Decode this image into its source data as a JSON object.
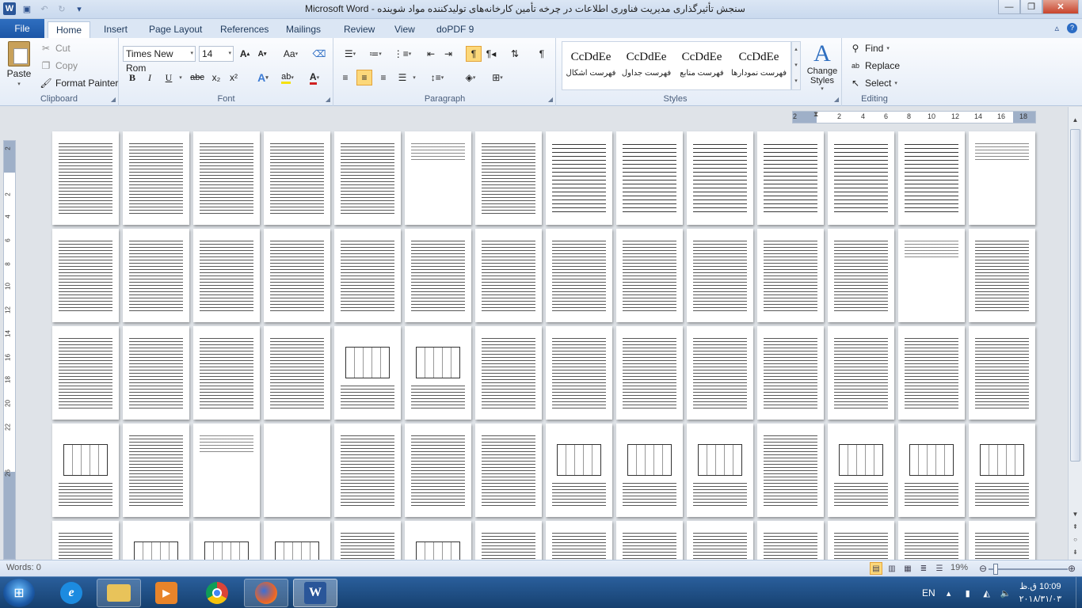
{
  "window": {
    "title": "سنجش تأثیرگذاری مدیریت فناوری اطلاعات در چرخه تأمین کارخانه‌های تولیدکننده مواد شوینده  -  Microsoft Word"
  },
  "quick_access": {
    "icons": [
      "word-icon",
      "save-icon",
      "undo-icon",
      "redo-icon",
      "customize-icon"
    ]
  },
  "tabs": [
    "File",
    "Home",
    "Insert",
    "Page Layout",
    "References",
    "Mailings",
    "Review",
    "View",
    "doPDF 9"
  ],
  "active_tab": "Home",
  "clipboard": {
    "paste": "Paste",
    "cut": "Cut",
    "copy": "Copy",
    "format_painter": "Format Painter",
    "label": "Clipboard"
  },
  "font": {
    "name": "Times New Rom",
    "size": "14",
    "label": "Font",
    "bold": "B",
    "italic": "I",
    "underline": "U",
    "strike": "abc",
    "subscript": "x₂",
    "superscript": "x²",
    "grow": "A",
    "shrink": "A",
    "change_case": "Aa"
  },
  "paragraph": {
    "label": "Paragraph",
    "pilcrow": "¶"
  },
  "styles": {
    "label": "Styles",
    "items": [
      {
        "sample": "CcDdEe",
        "name": "فهرست اشکال"
      },
      {
        "sample": "CcDdEe",
        "name": "فهرست جداول"
      },
      {
        "sample": "CcDdEe",
        "name": "فهرست منابع"
      },
      {
        "sample": "CcDdEe",
        "name": "فهرست نمودارها"
      }
    ],
    "change_styles": "Change Styles"
  },
  "editing": {
    "label": "Editing",
    "find": "Find",
    "replace": "Replace",
    "select": "Select"
  },
  "ruler": {
    "top_ticks": [
      "2",
      "2",
      "4",
      "6",
      "8",
      "10",
      "12",
      "14",
      "16",
      "18"
    ],
    "left_ticks": [
      "2",
      "2",
      "4",
      "6",
      "8",
      "10",
      "12",
      "14",
      "16",
      "18",
      "20",
      "22",
      "26"
    ]
  },
  "status": {
    "words": "Words: 0",
    "zoom": "19%"
  },
  "taskbar": {
    "language": "EN",
    "time": "10:09 ق.ظ",
    "date": "۲۰۱۸/۳۱/۰۳",
    "apps": [
      "internet-explorer-icon",
      "file-explorer-icon",
      "media-player-icon",
      "chrome-icon",
      "firefox-icon",
      "word-icon"
    ]
  }
}
